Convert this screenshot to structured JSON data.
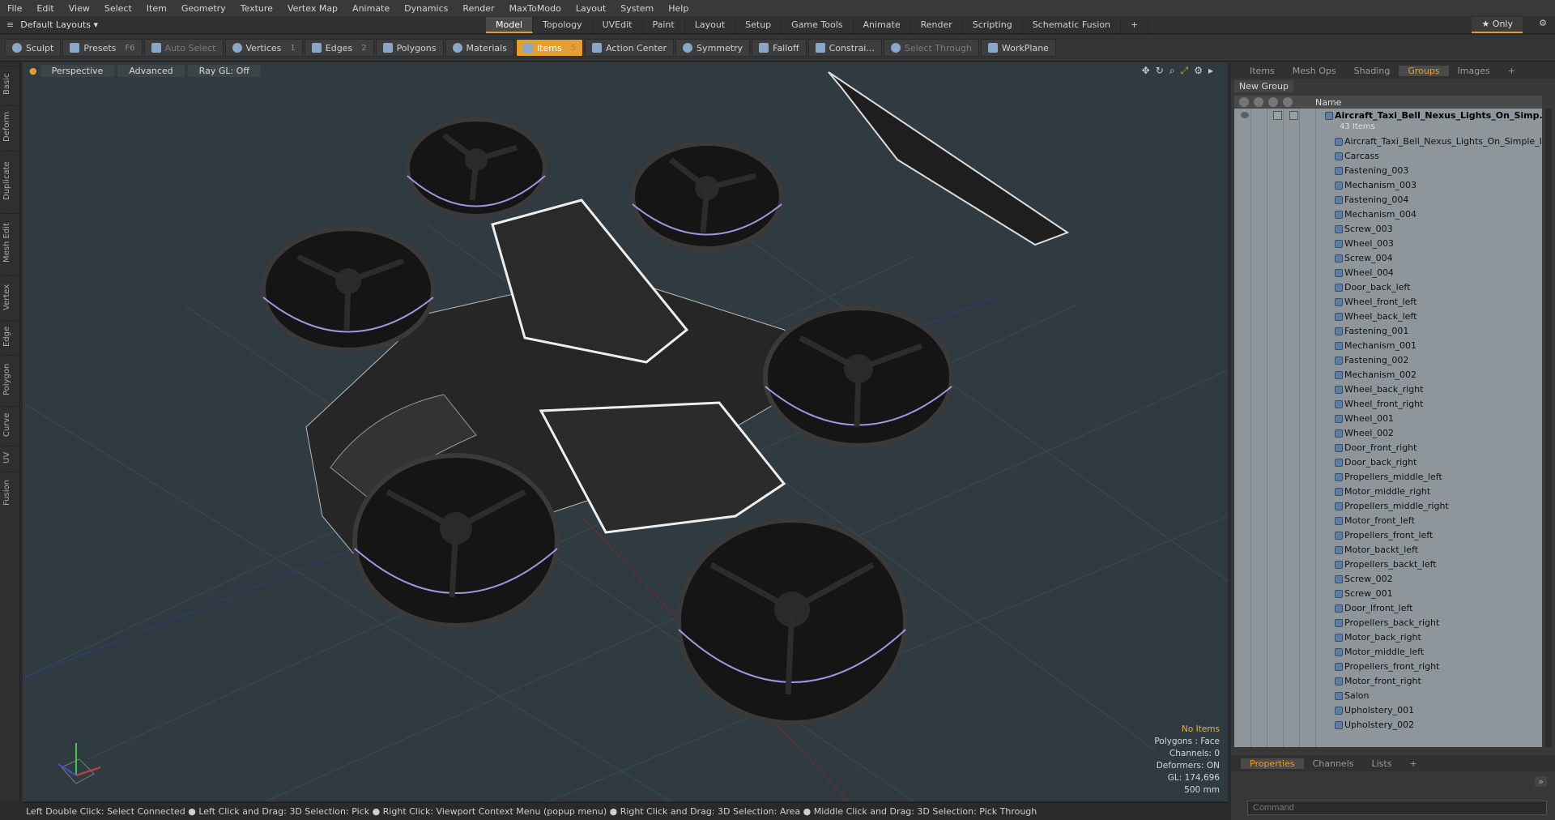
{
  "menu": [
    "File",
    "Edit",
    "View",
    "Select",
    "Item",
    "Geometry",
    "Texture",
    "Vertex Map",
    "Animate",
    "Dynamics",
    "Render",
    "MaxToModo",
    "Layout",
    "System",
    "Help"
  ],
  "layout_selector": "Default Layouts ▾",
  "layout_tabs": [
    {
      "label": "Model",
      "active": true
    },
    {
      "label": "Topology"
    },
    {
      "label": "UVEdit"
    },
    {
      "label": "Paint"
    },
    {
      "label": "Layout"
    },
    {
      "label": "Setup"
    },
    {
      "label": "Game Tools"
    },
    {
      "label": "Animate"
    },
    {
      "label": "Render"
    },
    {
      "label": "Scripting"
    },
    {
      "label": "Schematic Fusion"
    },
    {
      "label": "+"
    }
  ],
  "only_label": "★  Only",
  "toolbar": [
    {
      "label": "Sculpt",
      "icon": "brush-icon"
    },
    {
      "label": "Presets",
      "num": "F6",
      "icon": "presets-icon"
    },
    {
      "label": "Auto Select",
      "dim": true,
      "icon": "auto-select-icon"
    },
    {
      "label": "Vertices",
      "num": "1",
      "icon": "vertices-icon"
    },
    {
      "label": "Edges",
      "num": "2",
      "icon": "edges-icon"
    },
    {
      "label": "Polygons",
      "icon": "polygons-icon"
    },
    {
      "label": "Materials",
      "icon": "materials-icon"
    },
    {
      "label": "Items",
      "num": "5",
      "active": true,
      "icon": "items-icon"
    },
    {
      "label": "Action Center",
      "icon": "action-center-icon"
    },
    {
      "label": "Symmetry",
      "icon": "symmetry-icon"
    },
    {
      "label": "Falloff",
      "icon": "falloff-icon"
    },
    {
      "label": "Constrai...",
      "icon": "constraint-icon"
    },
    {
      "label": "Select Through",
      "dim": true,
      "icon": "select-through-icon"
    },
    {
      "label": "WorkPlane",
      "icon": "workplane-icon"
    }
  ],
  "left_tabs": [
    "Basic",
    "Deform",
    "Duplicate",
    "Mesh Edit",
    "Vertex",
    "Edge",
    "Polygon",
    "Curve",
    "UV",
    "Fusion"
  ],
  "viewport": {
    "view_mode": "Perspective",
    "shading": "Advanced",
    "raygl": "Ray GL: Off",
    "info": {
      "selection": "No Items",
      "polygons": "Polygons : Face",
      "channels": "Channels: 0",
      "deformers": "Deformers: ON",
      "gl": "GL: 174,696",
      "size": "500 mm"
    }
  },
  "status": "Left Double Click: Select Connected ● Left Click and Drag: 3D Selection: Pick ● Right Click: Viewport Context Menu (popup menu) ● Right Click and Drag: 3D Selection: Area ● Middle Click and Drag: 3D Selection: Pick Through",
  "right_tabs": [
    {
      "label": "Items"
    },
    {
      "label": "Mesh Ops"
    },
    {
      "label": "Shading"
    },
    {
      "label": "Groups",
      "active": true
    },
    {
      "label": "Images"
    },
    {
      "label": "+"
    }
  ],
  "new_group": "New Group",
  "list_header": "Name",
  "root_item": "Aircraft_Taxi_Bell_Nexus_Lights_On_Simp...",
  "root_count": "43 Items",
  "items": [
    "Aircraft_Taxi_Bell_Nexus_Lights_On_Simple_In ...",
    "Carcass",
    "Fastening_003",
    "Mechanism_003",
    "Fastening_004",
    "Mechanism_004",
    "Screw_003",
    "Wheel_003",
    "Screw_004",
    "Wheel_004",
    "Door_back_left",
    "Wheel_front_left",
    "Wheel_back_left",
    "Fastening_001",
    "Mechanism_001",
    "Fastening_002",
    "Mechanism_002",
    "Wheel_back_right",
    "Wheel_front_right",
    "Wheel_001",
    "Wheel_002",
    "Door_front_right",
    "Door_back_right",
    "Propellers_middle_left",
    "Motor_middle_right",
    "Propellers_middle_right",
    "Motor_front_left",
    "Propellers_front_left",
    "Motor_backt_left",
    "Propellers_backt_left",
    "Screw_002",
    "Screw_001",
    "Door_lfront_left",
    "Propellers_back_right",
    "Motor_back_right",
    "Motor_middle_left",
    "Propellers_front_right",
    "Motor_front_right",
    "Salon",
    "Upholstery_001",
    "Upholstery_002"
  ],
  "props_tabs": [
    {
      "label": "Properties",
      "active": true
    },
    {
      "label": "Channels"
    },
    {
      "label": "Lists"
    },
    {
      "label": "+"
    }
  ],
  "command_placeholder": "Command"
}
